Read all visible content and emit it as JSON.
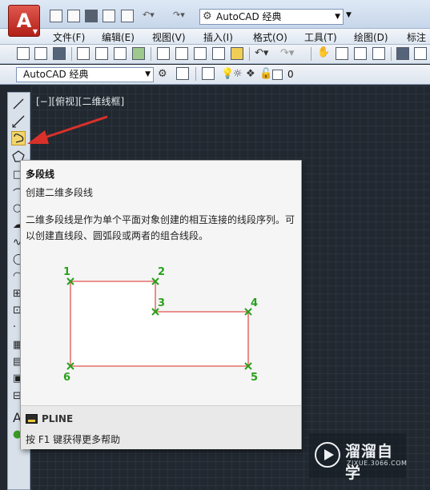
{
  "window": {
    "workspace": "AutoCAD 经典"
  },
  "menubar": {
    "items": [
      "文件(F)",
      "编辑(E)",
      "视图(V)",
      "插入(I)",
      "格式(O)",
      "工具(T)",
      "绘图(D)",
      "标注"
    ]
  },
  "toolbar2": {
    "workspace": "AutoCAD 经典",
    "layer_name": "0"
  },
  "canvas": {
    "viewport_label": "[−][俯视][二维线框]"
  },
  "tooltip": {
    "title": "多段线",
    "subtitle": "创建二维多段线",
    "description": "二维多段线是作为单个平面对象创建的相互连接的线段序列。可以创建直线段、圆弧段或两者的组合线段。",
    "figure_points": [
      "1",
      "2",
      "3",
      "4",
      "5",
      "6"
    ],
    "command": "PLINE",
    "help": "按 F1 键获得更多帮助"
  },
  "watermark": {
    "name": "溜溜自学",
    "url": "ZIXUE.3066.COM"
  },
  "colors": {
    "canvas": "#212830",
    "accent_red": "#d9302a",
    "figure_green": "#2aa01d",
    "figure_outline": "#e0534e"
  }
}
